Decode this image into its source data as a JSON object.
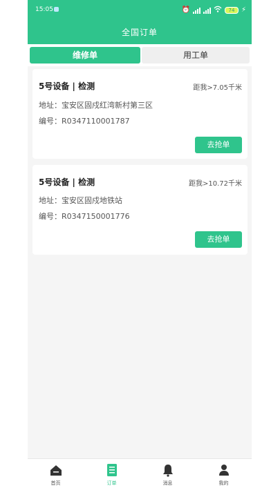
{
  "status_bar": {
    "time": "15:05",
    "battery": "74"
  },
  "header": {
    "title": "全国订单"
  },
  "tabs": [
    {
      "label": "维修单",
      "active": true
    },
    {
      "label": "用工单",
      "active": false
    }
  ],
  "orders": [
    {
      "title": "5号设备 | 检测",
      "distance": "距我>7.05千米",
      "address": "地址：宝安区固戍红湾新村第三区",
      "number": "编号：R0347110001787",
      "button": "去抢单"
    },
    {
      "title": "5号设备 | 检测",
      "distance": "距我>10.72千米",
      "address": "地址：宝安区固戍地铁站",
      "number": "编号：R0347150001776",
      "button": "去抢单"
    }
  ],
  "bottom_nav": [
    {
      "label": "首页",
      "icon": "home-icon",
      "active": false
    },
    {
      "label": "订单",
      "icon": "order-list-icon",
      "active": true
    },
    {
      "label": "消息",
      "icon": "bell-icon",
      "active": false
    },
    {
      "label": "我的",
      "icon": "user-icon",
      "active": false
    }
  ],
  "colors": {
    "brand": "#2fc48c",
    "background": "#f5f5f5",
    "card": "#ffffff"
  }
}
